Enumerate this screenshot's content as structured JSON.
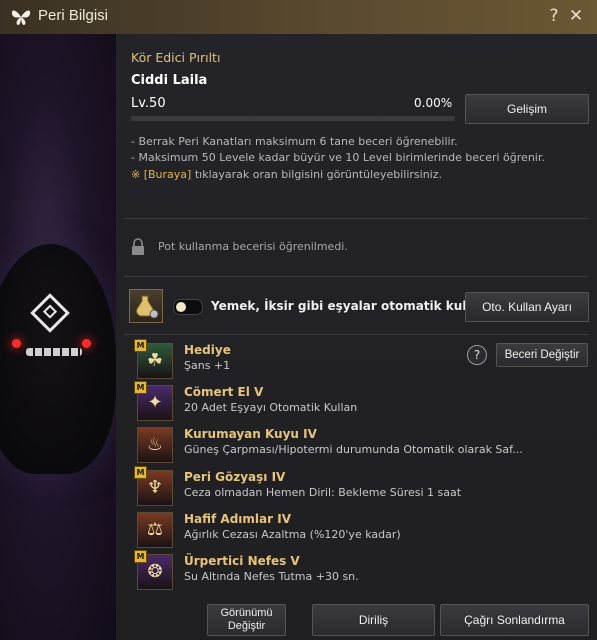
{
  "window": {
    "title": "Peri Bilgisi",
    "help_glyph": "?",
    "close_glyph": "✕"
  },
  "peri": {
    "type_name": "Kör Edici Pırıltı",
    "name": "Ciddi Laila",
    "level": "Lv.50",
    "progress_text": "0.00%",
    "progress_fraction": 0.0,
    "evolve_button": "Gelişim"
  },
  "info": {
    "line1": "- Berrak Peri Kanatları maksimum 6 tane beceri öğrenebilir.",
    "line2": "- Maksimum 50 Levele kadar büyür ve 10 Level birimlerinde beceri öğrenir.",
    "link_symbol": "※",
    "link_text": "[Buraya]",
    "link_rest": " tıklayarak oran bilgisini görüntüleyebilirsiniz."
  },
  "pot": {
    "text": "Pot kullanma becerisi öğrenilmedi."
  },
  "auto_use": {
    "text": "Yemek, İksir gibi eşyalar otomatik kullanılır.",
    "settings_button": "Oto. Kullan Ayarı",
    "toggle_on": false
  },
  "skills": [
    {
      "badge": "M",
      "name": "Hediye",
      "desc": "Şans +1",
      "icon": "clover-icon",
      "color": "#2e5a3a"
    },
    {
      "badge": "M",
      "name": "Cömert El V",
      "desc": "20 Adet Eşyayı Otomatik Kullan",
      "icon": "fairy-icon",
      "color": "#4a2a6a"
    },
    {
      "badge": "",
      "name": "Kurumayan Kuyu IV",
      "desc": "Güneş Çarpması/Hipotermi durumunda Otomatik olarak Saf...",
      "icon": "cup-icon",
      "color": "#7a3a22"
    },
    {
      "badge": "M",
      "name": "Peri Gözyaşı IV",
      "desc": "Ceza olmadan Hemen Diril: Bekleme Süresi 1 saat",
      "icon": "tear-icon",
      "color": "#7a3a22"
    },
    {
      "badge": "",
      "name": "Hafif Adımlar IV",
      "desc": "Ağırlık Cezası Azaltma (%120'ye kadar)",
      "icon": "weight-icon",
      "color": "#7a3a22"
    },
    {
      "badge": "M",
      "name": "Ürpertici Nefes V",
      "desc": "Su Altında Nefes Tutma +30 sn.",
      "icon": "breath-icon",
      "color": "#4a2a6a"
    }
  ],
  "skill_change_button": "Beceri Değiştir",
  "help_glyph": "?",
  "bottom": {
    "appearance_line1": "Görünümü",
    "appearance_line2": "Değiştir",
    "revive": "Diriliş",
    "end_summon": "Çağrı Sonlandırma"
  }
}
